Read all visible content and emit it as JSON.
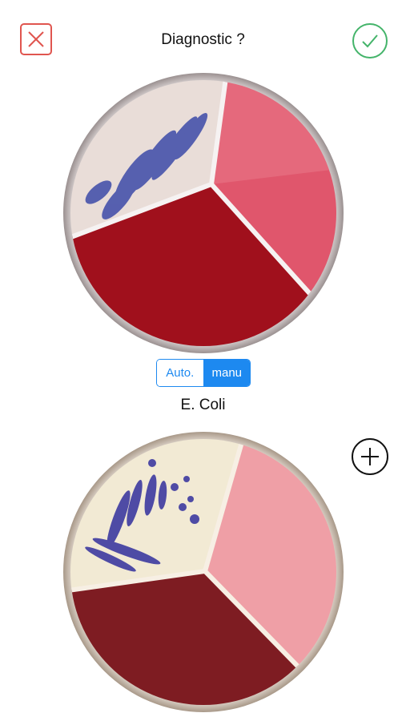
{
  "header": {
    "title": "Diagnostic ?",
    "close_icon": "close-icon",
    "confirm_icon": "check-icon"
  },
  "mode_toggle": {
    "options": [
      "Auto.",
      "manu"
    ],
    "selected": "manu"
  },
  "result": {
    "label": "E. Coli"
  },
  "add_icon": "plus-icon",
  "colors": {
    "close": "#e0554f",
    "confirm": "#44b46a",
    "accent": "#1d89f0",
    "plate_blood": "#a0101c",
    "plate_pink": "#e0566c",
    "plate_cream": "#f2ead4",
    "colonies": "#3d4aa8"
  }
}
